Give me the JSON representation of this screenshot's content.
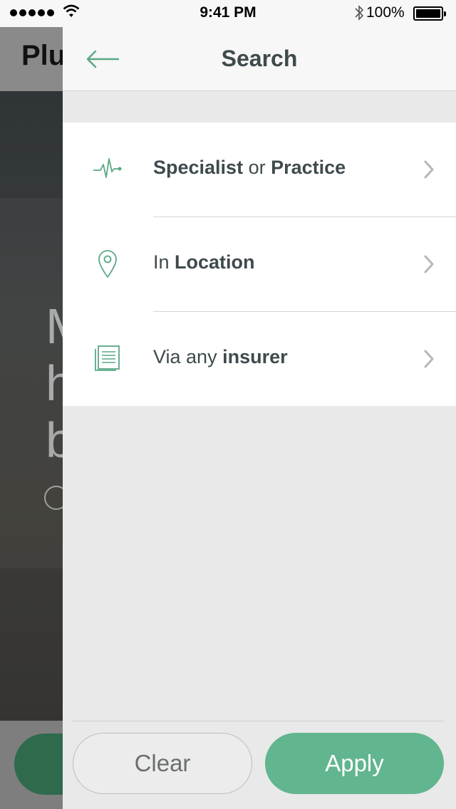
{
  "status_bar": {
    "time": "9:41 PM",
    "battery": "100%"
  },
  "background_page": {
    "title_partial": "Plu",
    "hero_lines": [
      "M",
      "h",
      "b"
    ]
  },
  "drawer": {
    "title": "Search",
    "items": [
      {
        "icon": "pulse-icon",
        "parts": [
          {
            "text": "Specialist",
            "bold": true
          },
          {
            "text": " or ",
            "bold": false
          },
          {
            "text": "Practice",
            "bold": true
          }
        ]
      },
      {
        "icon": "location-pin-icon",
        "parts": [
          {
            "text": "In ",
            "bold": false
          },
          {
            "text": "Location",
            "bold": true
          }
        ]
      },
      {
        "icon": "document-icon",
        "parts": [
          {
            "text": "Via any ",
            "bold": false
          },
          {
            "text": "insurer",
            "bold": true
          }
        ]
      }
    ],
    "clear_label": "Clear",
    "apply_label": "Apply"
  },
  "colors": {
    "accent": "#61b58f",
    "icon_green": "#5aa884",
    "text_dark": "#3f4a4d"
  }
}
